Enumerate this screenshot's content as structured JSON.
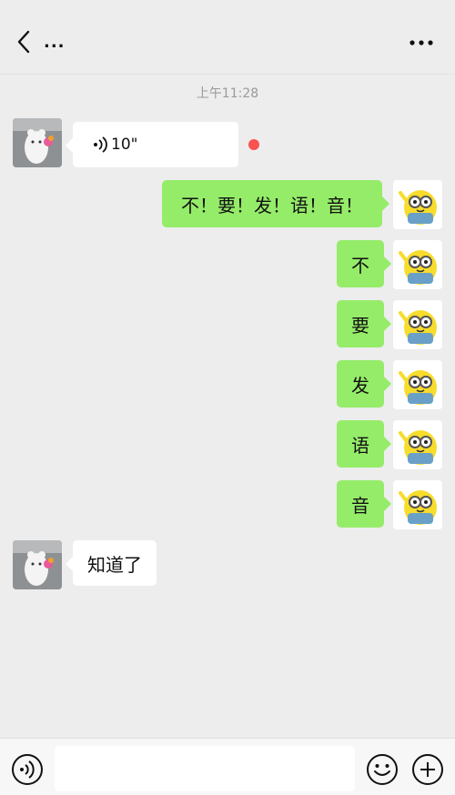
{
  "header": {
    "title": "...",
    "back_icon": "chevron-left-icon",
    "more_icon": "more-dots-icon"
  },
  "timestamp": "上午11:28",
  "messages": [
    {
      "side": "in",
      "type": "voice",
      "text": "10\"",
      "unread": true
    },
    {
      "side": "out",
      "type": "text",
      "text": "不！要！发！语！音！"
    },
    {
      "side": "out",
      "type": "text",
      "text": "不"
    },
    {
      "side": "out",
      "type": "text",
      "text": "要"
    },
    {
      "side": "out",
      "type": "text",
      "text": "发"
    },
    {
      "side": "out",
      "type": "text",
      "text": "语"
    },
    {
      "side": "out",
      "type": "text",
      "text": "音"
    },
    {
      "side": "in",
      "type": "text",
      "text": "知道了"
    }
  ],
  "input_bar": {
    "voice_icon": "voice-mode-icon",
    "emoji_icon": "emoji-icon",
    "plus_icon": "plus-icon",
    "input_value": ""
  },
  "colors": {
    "background": "#ededed",
    "bubble_out": "#95ec69",
    "bubble_in": "#ffffff",
    "unread_dot": "#fa5151"
  }
}
